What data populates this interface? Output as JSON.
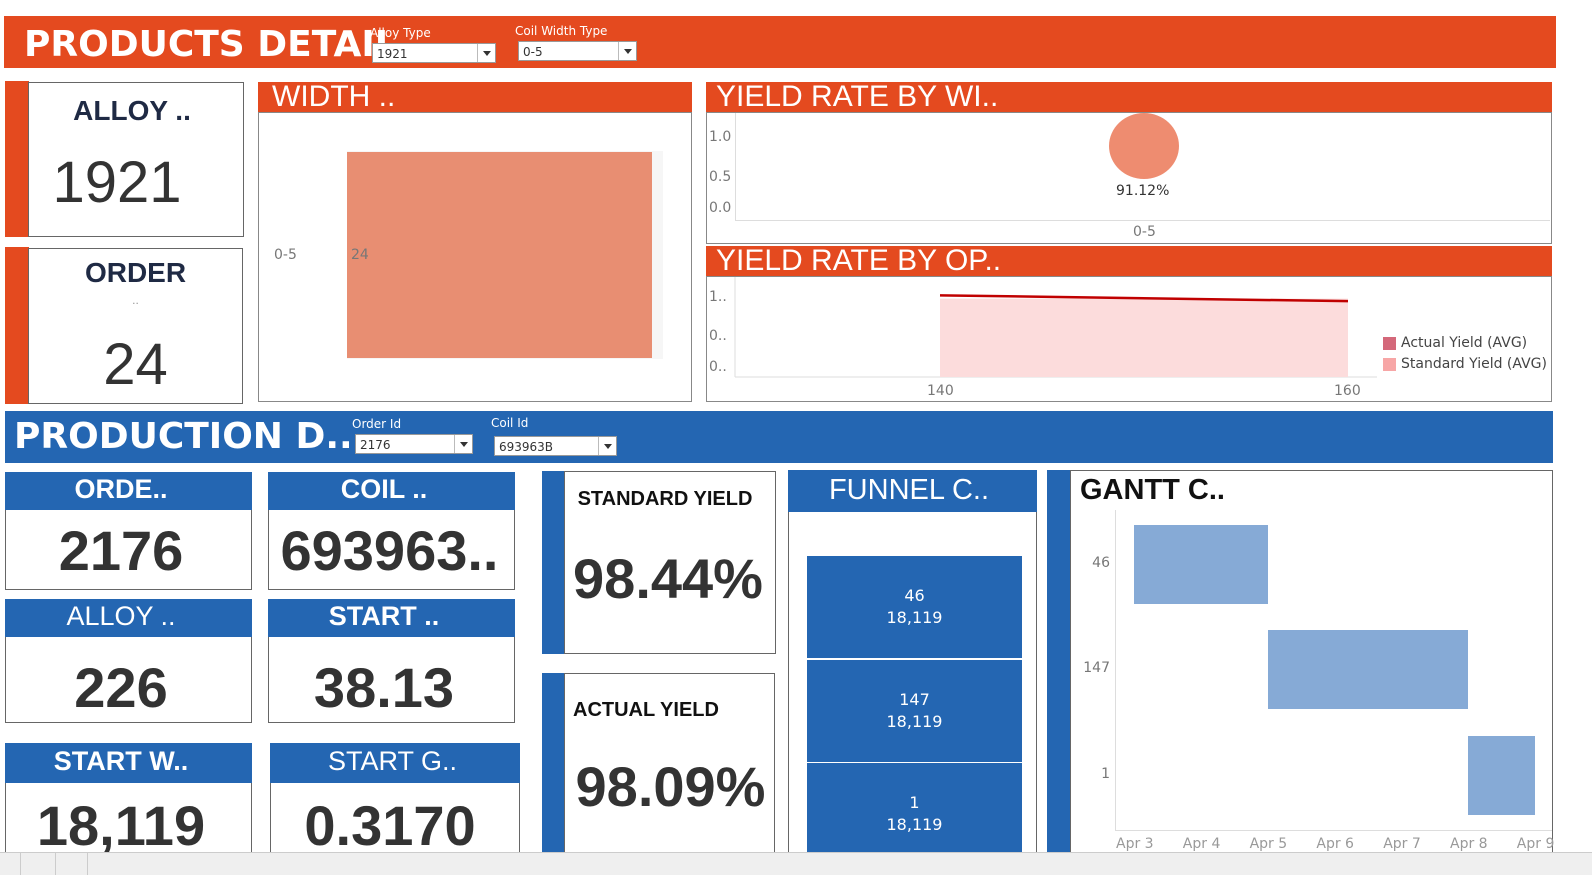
{
  "products_header": {
    "title": "PRODUCTS DETAIL",
    "filters": [
      {
        "label": "Alloy Type",
        "value": "1921"
      },
      {
        "label": "Coil Width Type",
        "value": "0-5"
      }
    ]
  },
  "alloy_card": {
    "title": "ALLOY ..",
    "value": "1921"
  },
  "order_card": {
    "title": "ORDER",
    "subtitle": "..",
    "value": "24"
  },
  "width_panel": {
    "title": "WIDTH ..",
    "chart_data": {
      "type": "bar",
      "orientation": "horizontal",
      "categories": [
        "0-5"
      ],
      "values": [
        24
      ],
      "value_labels": [
        "24"
      ]
    }
  },
  "yield_width_panel": {
    "title": "YIELD RATE BY WI..",
    "chart_data": {
      "type": "scatter",
      "x": [
        "0-5"
      ],
      "y": [
        0.9112
      ],
      "data_labels": [
        "91.12%"
      ],
      "y_ticks": [
        "1.0",
        "0.5",
        "0.0"
      ],
      "x_ticks": [
        "0-5"
      ],
      "ylim": [
        0,
        1
      ]
    }
  },
  "yield_op_panel": {
    "title": "YIELD RATE BY OP..",
    "chart_data": {
      "type": "area",
      "x": [
        140,
        160
      ],
      "x_ticks": [
        "140",
        "160"
      ],
      "y_ticks": [
        "1..",
        "0..",
        "0.."
      ],
      "ylim": [
        0,
        1.2
      ],
      "series": [
        {
          "name": "Actual Yield (AVG)",
          "type": "line",
          "values": [
            0.98,
            0.91
          ],
          "color": "#c00000"
        },
        {
          "name": "Standard Yield (AVG)",
          "type": "area",
          "values": [
            0.94,
            0.94
          ],
          "color": "#fcdcdc"
        }
      ],
      "legend_position": "right"
    },
    "legend": [
      {
        "label": "Actual Yield (AVG)",
        "color": "#d4687a"
      },
      {
        "label": "Standard Yield (AVG)",
        "color": "#f7a6a6"
      }
    ]
  },
  "production_header": {
    "title": "PRODUCTION D..",
    "filters": [
      {
        "label": "Order Id",
        "value": "2176"
      },
      {
        "label": "Coil Id",
        "value": "693963B"
      }
    ]
  },
  "kpis": {
    "order": {
      "title": "ORDE..",
      "value": "2176"
    },
    "coil": {
      "title": "COIL ..",
      "value": "693963.."
    },
    "alloy": {
      "title": "ALLOY ..",
      "value": "226"
    },
    "start": {
      "title": "START ..",
      "value": "38.13"
    },
    "start_w": {
      "title": "START W..",
      "value": "18,119"
    },
    "start_g": {
      "title": "START G..",
      "value": "0.3170"
    }
  },
  "standard_yield": {
    "title": "STANDARD YIELD",
    "value": "98.44%"
  },
  "actual_yield": {
    "title": "ACTUAL YIELD",
    "value": "98.09%"
  },
  "funnel": {
    "title": "FUNNEL C..",
    "chart_data": {
      "type": "bar",
      "categories": [
        "46",
        "147",
        "1"
      ],
      "values": [
        18119,
        18119,
        18119
      ],
      "value_labels": [
        "18,119",
        "18,119",
        "18,119"
      ]
    }
  },
  "gantt": {
    "title": "GANTT C..",
    "chart_data": {
      "type": "bar",
      "orientation": "gantt",
      "categories": [
        "46",
        "147",
        "1"
      ],
      "x_ticks": [
        "Apr 3",
        "Apr 4",
        "Apr 5",
        "Apr 6",
        "Apr 7",
        "Apr 8",
        "Apr 9"
      ],
      "tasks": [
        {
          "label": "46",
          "start": "Apr 3",
          "end": "Apr 5"
        },
        {
          "label": "147",
          "start": "Apr 5",
          "end": "Apr 8"
        },
        {
          "label": "1",
          "start": "Apr 8",
          "end": "Apr 9"
        }
      ],
      "color": "#86aad6"
    }
  }
}
